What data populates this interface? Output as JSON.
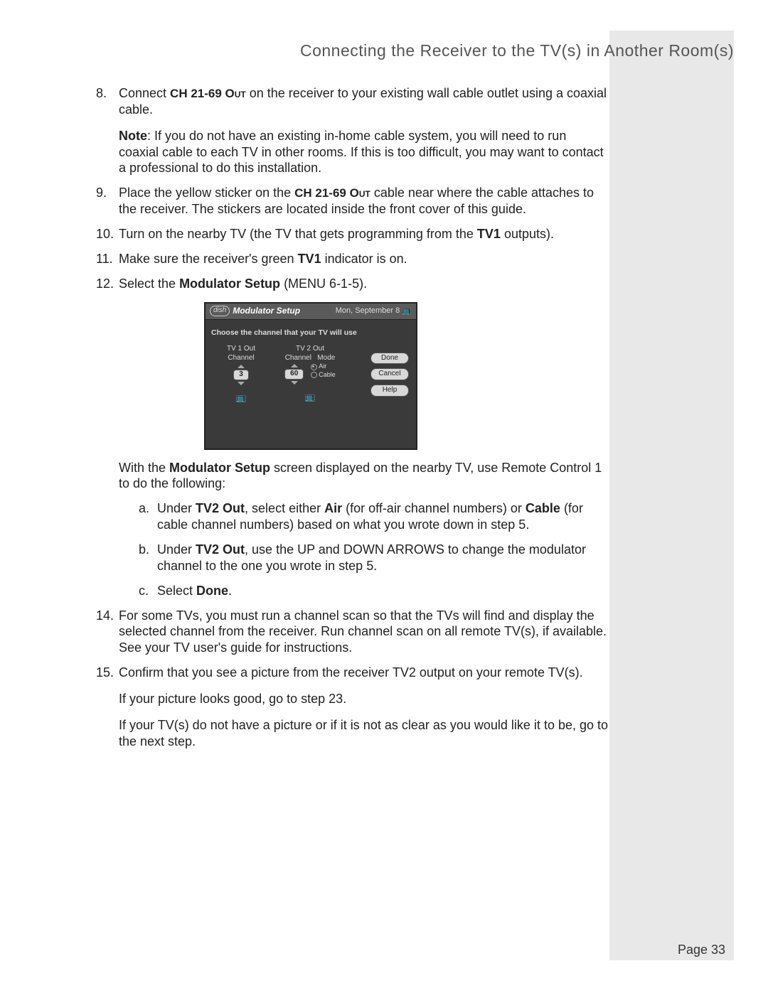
{
  "header": {
    "title": "Connecting the Receiver to the TV(s) in Another Room(s)"
  },
  "steps": {
    "s8": {
      "num": "8.",
      "p1a": "Connect ",
      "p1b": "CH 21-69 Out",
      "p1c": " on the receiver to your existing wall cable outlet using a coaxial cable.",
      "noteLabel": "Note",
      "noteText": ": If you do not have an existing in-home cable system, you will need to run coaxial cable to each TV in other rooms. If this is too difficult, you may want to contact a professional to do this installation."
    },
    "s9": {
      "num": "9.",
      "a": "Place the yellow sticker on the ",
      "b": "CH 21-69 Out",
      "c": " cable near where the cable attaches to the receiver. The stickers are located inside the front cover of this guide."
    },
    "s10": {
      "num": "10.",
      "a": "Turn on the nearby TV (the TV that gets programming from the ",
      "b": "TV1",
      "c": " outputs)."
    },
    "s11": {
      "num": "11.",
      "a": "Make sure the receiver's green ",
      "b": "TV1",
      "c": " indicator is on."
    },
    "s12": {
      "num": "12.",
      "a": "Select the ",
      "b": "Modulator Setup",
      "c": " (MENU 6-1-5)."
    },
    "after": {
      "p1a": "With the ",
      "p1b": "Modulator Setup",
      "p1c": " screen displayed on the nearby TV, use Remote Control 1 to do the following:",
      "a": {
        "sn": "a.",
        "t1": "Under ",
        "t2": "TV2 Out",
        "t3": ", select either ",
        "t4": "Air",
        "t5": " (for off-air channel numbers) or ",
        "t6": "Cable",
        "t7": " (for cable channel numbers) based on what you wrote down in step 5."
      },
      "b": {
        "sn": "b.",
        "t1": "Under ",
        "t2": "TV2 Out",
        "t3": ", use the ",
        "t4": "UP and DOWN ARROWS",
        "t5": " to change the modulator channel to the one you wrote in step 5."
      },
      "c": {
        "sn": "c.",
        "t1": "Select ",
        "t2": "Done",
        "t3": "."
      }
    },
    "s14": {
      "num": "14.",
      "t": "For some TVs, you must run a channel scan so that the TVs will find and display the selected channel from the receiver. Run channel scan on all remote TV(s), if available. See your TV user's guide for instructions."
    },
    "s15": {
      "num": "15.",
      "t1": "Confirm that you see a picture from the receiver TV2 output on your remote TV(s).",
      "t2": "If your picture looks good, go to step 23.",
      "t3": "If your TV(s) do not have a picture or if it is not as clear as you would like it to be, go to the next step."
    }
  },
  "figure": {
    "brand": "dish",
    "title": "Modulator Setup",
    "date": "Mon, September 8",
    "prompt": "Choose the channel that your TV will use",
    "tv1": {
      "label": "TV 1 Out",
      "chLabel": "Channel",
      "val": "3"
    },
    "tv2": {
      "label": "TV 2 Out",
      "chLabel": "Channel",
      "modeLabel": "Mode",
      "val": "60",
      "opt1": "Air",
      "opt2": "Cable"
    },
    "btns": {
      "done": "Done",
      "cancel": "Cancel",
      "help": "Help"
    },
    "tvicon": "📺"
  },
  "footer": {
    "page": "Page 33"
  }
}
